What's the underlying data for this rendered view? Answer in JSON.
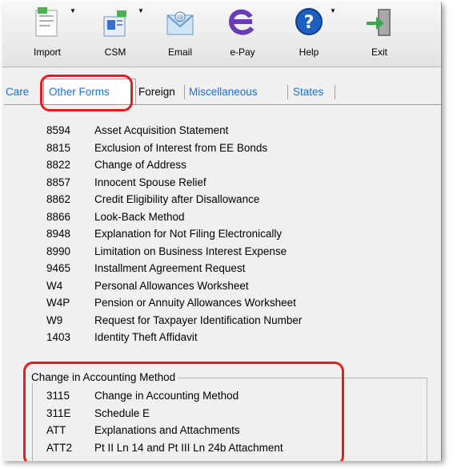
{
  "toolbar": {
    "buttons": [
      {
        "label": "Import",
        "icon": "import-icon"
      },
      {
        "label": "CSM",
        "icon": "csm-icon"
      },
      {
        "label": "Email",
        "icon": "email-icon"
      },
      {
        "label": "e-Pay",
        "icon": "epay-icon"
      },
      {
        "label": "Help",
        "icon": "help-icon"
      },
      {
        "label": "Exit",
        "icon": "exit-icon"
      }
    ]
  },
  "tabs": {
    "care": "Care",
    "other_forms": "Other Forms",
    "foreign": "Foreign",
    "miscellaneous": "Miscellaneous",
    "states": "States"
  },
  "forms": [
    {
      "code": "8594",
      "desc": "Asset Acquisition Statement"
    },
    {
      "code": "8815",
      "desc": "Exclusion of Interest from EE Bonds"
    },
    {
      "code": "8822",
      "desc": "Change of Address"
    },
    {
      "code": "8857",
      "desc": "Innocent Spouse Relief"
    },
    {
      "code": "8862",
      "desc": "Credit Eligibility after Disallowance"
    },
    {
      "code": "8866",
      "desc": "Look-Back Method"
    },
    {
      "code": "8948",
      "desc": "Explanation for Not Filing Electronically"
    },
    {
      "code": "8990",
      "desc": "Limitation on Business Interest Expense"
    },
    {
      "code": "9465",
      "desc": "Installment Agreement Request"
    },
    {
      "code": "W4",
      "desc": "Personal Allowances Worksheet"
    },
    {
      "code": "W4P",
      "desc": "Pension or Annuity Allowances Worksheet"
    },
    {
      "code": "W9",
      "desc": "Request for Taxpayer Identification Number"
    },
    {
      "code": "1403",
      "desc": "Identity Theft Affidavit"
    }
  ],
  "accounting_group": {
    "title": "Change in Accounting Method",
    "items": [
      {
        "code": "3115",
        "desc": "Change in Accounting Method"
      },
      {
        "code": "311E",
        "desc": "Schedule E"
      },
      {
        "code": "ATT",
        "desc": "Explanations and Attachments"
      },
      {
        "code": "ATT2",
        "desc": "Pt II Ln 14 and Pt III Ln 24b Attachment"
      }
    ]
  },
  "colors": {
    "tab_blue": "#1c6fd8",
    "highlight_red": "#e02020"
  }
}
